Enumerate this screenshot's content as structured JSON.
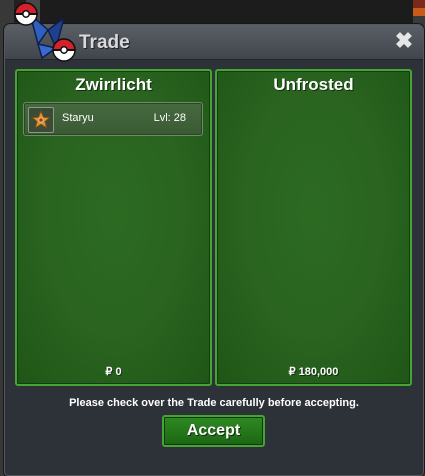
{
  "window": {
    "title": "Trade",
    "close_symbol": "✖"
  },
  "left_panel": {
    "player_name": "Zwirrlicht",
    "items": [
      {
        "icon": "staryu-star-icon",
        "name": "Staryu",
        "level": "Lvl: 28"
      }
    ],
    "money": "₽ 0"
  },
  "right_panel": {
    "player_name": "Unfrosted",
    "items": [],
    "money": "₽ 180,000"
  },
  "footer": {
    "notice": "Please check over the Trade carefully before accepting.",
    "accept_label": "Accept"
  },
  "colors": {
    "panel_green": "#2a6420",
    "panel_border": "#47a334",
    "window_bg": "#2d3238"
  }
}
